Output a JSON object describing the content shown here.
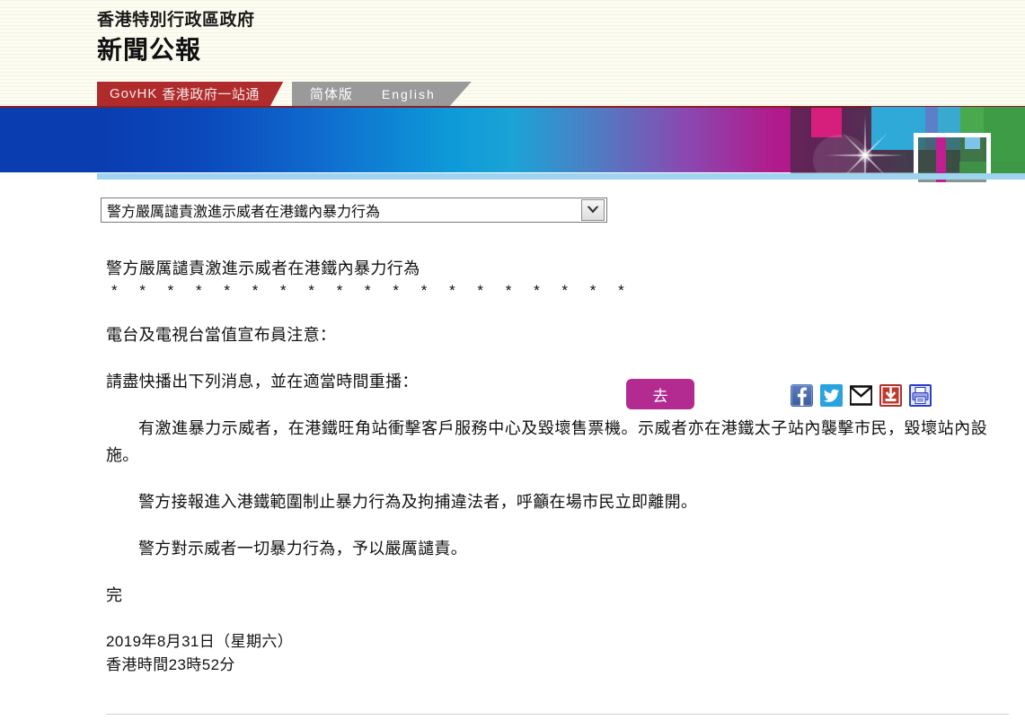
{
  "header": {
    "gov_name": "香港特別行政區政府",
    "site_name": "新聞公報",
    "nav": {
      "govhk_latin": "GovHK",
      "govhk_chinese": "香港政府一站通",
      "simplified": "简体版",
      "english": "English"
    }
  },
  "search": {
    "selected_option": "警方嚴厲譴責激進示威者在港鐵內暴力行為",
    "go_label": "去",
    "dropdown_icon": "chevron-down-icon"
  },
  "share": {
    "facebook": "facebook-icon",
    "twitter": "twitter-icon",
    "email": "email-icon",
    "download": "download-icon",
    "print": "print-icon"
  },
  "article": {
    "title": "警方嚴厲譴責激進示威者在港鐵內暴力行為",
    "stars": "* * * * * * * * * * * * * * * * * * *",
    "para1": "電台及電視台當值宣布員注意：",
    "para2": "請盡快播出下列消息，並在適當時間重播：",
    "para3": "有激進暴力示威者，在港鐵旺角站衝擊客戶服務中心及毀壞售票機。示威者亦在港鐵太子站內襲擊市民，毀壞站內設施。",
    "para4": "警方接報進入港鐵範圍制止暴力行為及拘捕違法者，呼籲在場市民立即離開。",
    "para5": "警方對示威者一切暴力行為，予以嚴厲譴責。",
    "end_mark": "完",
    "date_line": "2019年8月31日（星期六）",
    "time_line": "香港時間23時52分"
  },
  "colors": {
    "govhk_tab": "#b02b2b",
    "nav_gray": "#9a9a9a",
    "go_button": "#b32b91",
    "header_bg": "#fbfbee",
    "underbar": "#9ed4f0"
  }
}
